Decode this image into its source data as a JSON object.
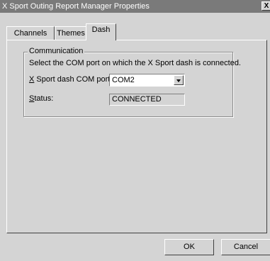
{
  "window": {
    "title": "X Sport Outing Report Manager Properties",
    "close_label": "X"
  },
  "tabs": [
    {
      "label": "Channels"
    },
    {
      "label": "Themes"
    },
    {
      "label": "Dash",
      "selected": true
    }
  ],
  "communication": {
    "group_label": "Communication",
    "description": "Select the COM port on which the X Sport dash is connected.",
    "port_label_underlined": "X",
    "port_label_rest": " Sport dash COM port:",
    "port_value": "COM2",
    "status_label_underlined": "S",
    "status_label_rest": "tatus:",
    "status_value": "CONNECTED"
  },
  "buttons": {
    "ok": "OK",
    "cancel": "Cancel"
  },
  "colors": {
    "titlebar": "#7a7a7a",
    "face": "#d4d4d4"
  }
}
